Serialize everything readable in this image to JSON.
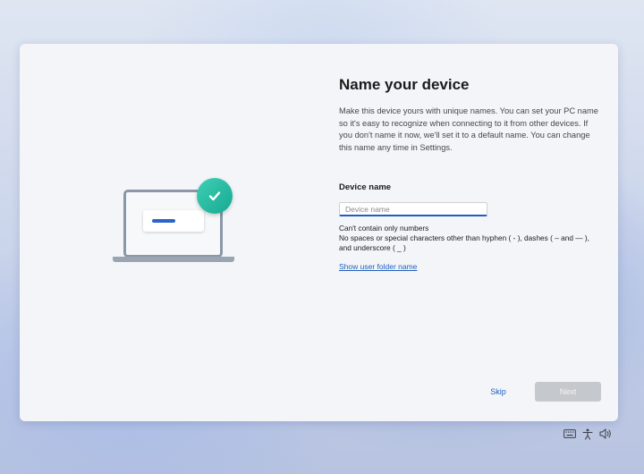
{
  "page": {
    "title": "Name your device",
    "description": "Make this device yours with unique names. You can set your PC name so it's easy to recognize when connecting to it from other devices. If you don't name it now, we'll set it to a default name. You can change this name any time in Settings."
  },
  "form": {
    "label": "Device name",
    "input_value": "",
    "input_placeholder": "Device name",
    "rule_1": "Can't contain only numbers",
    "rule_2": "No spaces or special characters other than hyphen ( - ), dashes ( – and — ), and underscore ( _ )",
    "link": "Show user folder name"
  },
  "buttons": {
    "skip": "Skip",
    "next": "Next"
  },
  "tray": {
    "icons": [
      "keyboard-icon",
      "accessibility-icon",
      "volume-icon"
    ]
  },
  "colors": {
    "accent": "#1f5fbf",
    "check": "#1db89f",
    "disabled_button": "#c5c8cd"
  }
}
